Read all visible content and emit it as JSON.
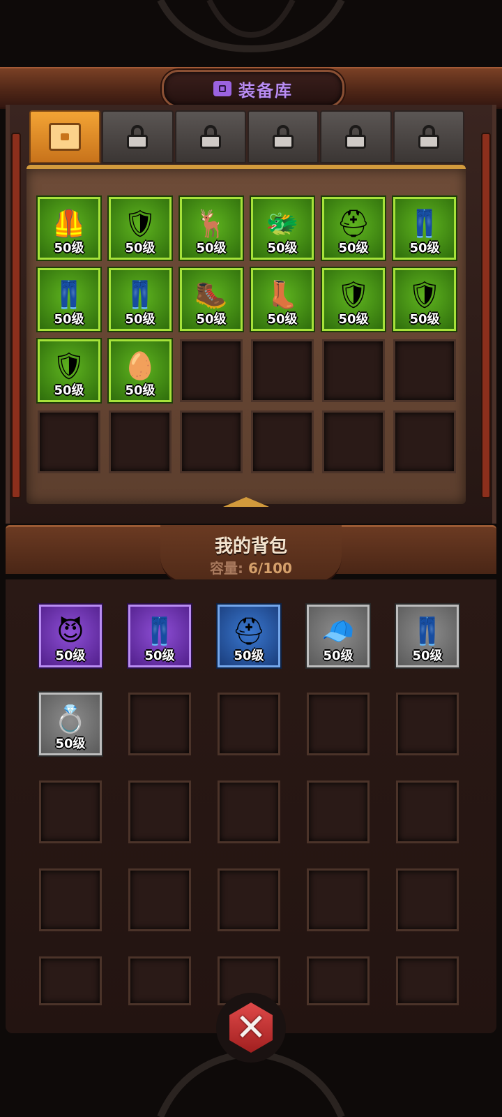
{
  "storage": {
    "title": "装备库",
    "title_icon": "storage-box-icon",
    "tabs": [
      {
        "icon": "chest-icon",
        "state": "active"
      },
      {
        "icon": "lock-icon",
        "state": "locked"
      },
      {
        "icon": "lock-icon",
        "state": "locked"
      },
      {
        "icon": "lock-icon",
        "state": "locked"
      },
      {
        "icon": "lock-icon",
        "state": "locked"
      },
      {
        "icon": "lock-icon",
        "state": "locked"
      }
    ],
    "slots": [
      {
        "rarity": "green",
        "icon": "chest-armor-icon",
        "glyph": "🦺",
        "level": "50级"
      },
      {
        "rarity": "green",
        "icon": "blue-armor-icon",
        "glyph": "🛡",
        "level": "50级"
      },
      {
        "rarity": "green",
        "icon": "antler-helmet-icon",
        "glyph": "🦌",
        "level": "50级"
      },
      {
        "rarity": "green",
        "icon": "dragon-helmet-icon",
        "glyph": "🐲",
        "level": "50级"
      },
      {
        "rarity": "green",
        "icon": "plumed-helmet-icon",
        "glyph": "⛑",
        "level": "50级"
      },
      {
        "rarity": "green",
        "icon": "dark-leggings-icon",
        "glyph": "👖",
        "level": "50级"
      },
      {
        "rarity": "green",
        "icon": "green-leggings-icon",
        "glyph": "👖",
        "level": "50级"
      },
      {
        "rarity": "green",
        "icon": "blue-leggings-icon",
        "glyph": "👖",
        "level": "50级"
      },
      {
        "rarity": "green",
        "icon": "fur-boots-icon",
        "glyph": "🥾",
        "level": "50级"
      },
      {
        "rarity": "green",
        "icon": "white-boots-icon",
        "glyph": "👢",
        "level": "50级"
      },
      {
        "rarity": "green",
        "icon": "steel-pauldron-icon",
        "glyph": "🛡",
        "level": "50级"
      },
      {
        "rarity": "green",
        "icon": "green-pauldron-icon",
        "glyph": "🛡",
        "level": "50级"
      },
      {
        "rarity": "green",
        "icon": "blue-shoulder-icon",
        "glyph": "🛡",
        "level": "50级"
      },
      {
        "rarity": "green",
        "icon": "purple-pauldron-icon",
        "glyph": "🥚",
        "level": "50级"
      }
    ],
    "total_slots": 24
  },
  "bag": {
    "title": "我的背包",
    "capacity_label": "容量:",
    "capacity_value": "6/100",
    "slots": [
      {
        "rarity": "purple",
        "icon": "horned-helmet-icon",
        "glyph": "😈",
        "level": "50级"
      },
      {
        "rarity": "purple",
        "icon": "leather-pants-icon",
        "glyph": "👖",
        "level": "50级"
      },
      {
        "rarity": "blue",
        "icon": "spiked-helmet-icon",
        "glyph": "⛑",
        "level": "50级"
      },
      {
        "rarity": "gray",
        "icon": "hair-hood-icon",
        "glyph": "🧢",
        "level": "50级"
      },
      {
        "rarity": "gray",
        "icon": "brown-pants-icon",
        "glyph": "👖",
        "level": "50级"
      },
      {
        "rarity": "gray",
        "icon": "ruby-ring-icon",
        "glyph": "💍",
        "level": "50级"
      }
    ],
    "visible_slots": 25
  },
  "close_button": {
    "icon": "close-icon",
    "glyph": "✕"
  },
  "colors": {
    "common": "#5a5a5a",
    "uncommon": "#4f9e1a",
    "rare": "#2f5fae",
    "epic": "#6e34b4",
    "accent": "#b98cf2"
  }
}
